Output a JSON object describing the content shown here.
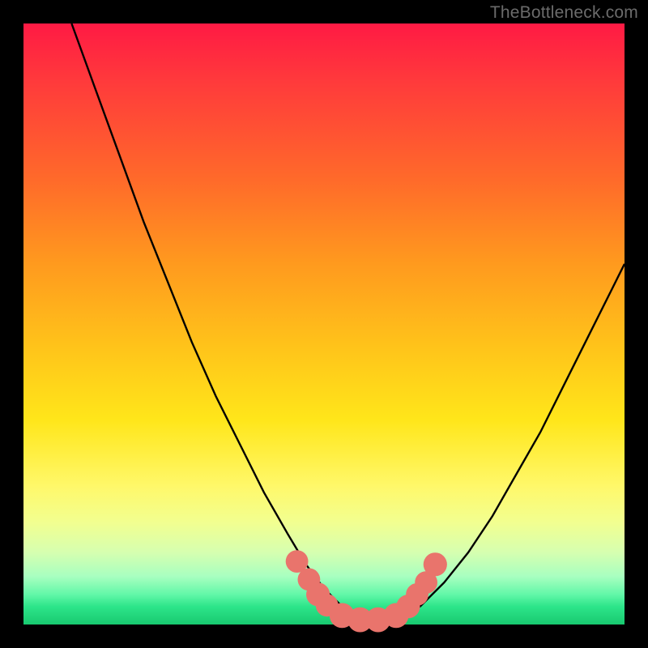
{
  "watermark": {
    "text": "TheBottleneck.com"
  },
  "colors": {
    "background": "#000000",
    "curve_stroke": "#000000",
    "marker_fill": "#e9746c",
    "marker_stroke": "#cf5a55"
  },
  "chart_data": {
    "type": "line",
    "title": "",
    "xlabel": "",
    "ylabel": "",
    "xlim": [
      0,
      100
    ],
    "ylim": [
      0,
      100
    ],
    "grid": false,
    "legend": false,
    "series": [
      {
        "name": "bottleneck-curve",
        "x": [
          8,
          12,
          16,
          20,
          24,
          28,
          32,
          36,
          40,
          44,
          47,
          50,
          53,
          56,
          59,
          62,
          66,
          70,
          74,
          78,
          82,
          86,
          90,
          94,
          98,
          100
        ],
        "y": [
          100,
          89,
          78,
          67,
          57,
          47,
          38,
          30,
          22,
          15,
          10,
          6,
          3,
          1,
          0.5,
          1,
          3,
          7,
          12,
          18,
          25,
          32,
          40,
          48,
          56,
          60
        ]
      }
    ],
    "markers": [
      {
        "x": 45.5,
        "y": 10.5,
        "r": 1.2
      },
      {
        "x": 47.5,
        "y": 7.5,
        "r": 1.2
      },
      {
        "x": 49.0,
        "y": 5.0,
        "r": 1.3
      },
      {
        "x": 50.5,
        "y": 3.2,
        "r": 1.2
      },
      {
        "x": 53.0,
        "y": 1.5,
        "r": 1.4
      },
      {
        "x": 56.0,
        "y": 0.8,
        "r": 1.4
      },
      {
        "x": 59.0,
        "y": 0.8,
        "r": 1.4
      },
      {
        "x": 62.0,
        "y": 1.5,
        "r": 1.4
      },
      {
        "x": 64.0,
        "y": 3.0,
        "r": 1.3
      },
      {
        "x": 65.5,
        "y": 5.0,
        "r": 1.2
      },
      {
        "x": 67.0,
        "y": 7.0,
        "r": 1.2
      },
      {
        "x": 68.5,
        "y": 10.0,
        "r": 1.3
      }
    ]
  }
}
